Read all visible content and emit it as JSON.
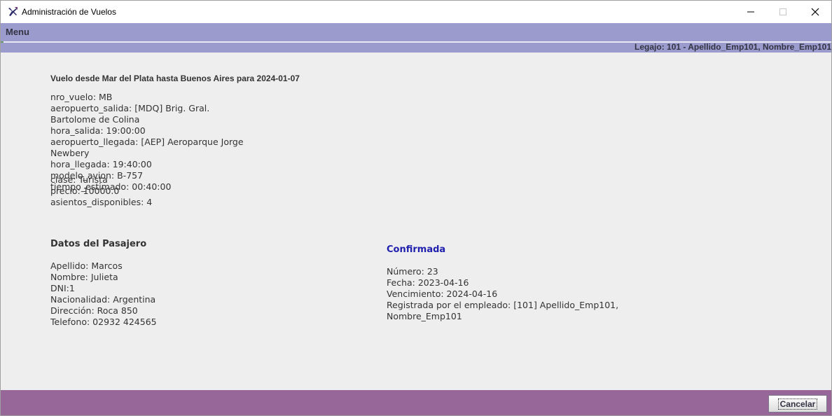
{
  "window": {
    "title": "Administración de Vuelos",
    "app_icon": "airplane-icon",
    "controls": [
      "minimize-icon",
      "maximize-icon",
      "close-icon"
    ]
  },
  "menubar": {
    "menu_label": "Menu"
  },
  "status": {
    "legajo": "Legajo: 101 - Apellido_Emp101, Nombre_Emp101"
  },
  "flight": {
    "title": "Vuelo desde Mar del Plata hasta Buenos Aires para 2024-01-07",
    "nro_vuelo": "nro_vuelo: MB",
    "aeropuerto_salida_l1": "aeropuerto_salida: [MDQ] Brig. Gral.",
    "aeropuerto_salida_l2": "Bartolome de Colina",
    "hora_salida": "hora_salida: 19:00:00",
    "aeropuerto_llegada_l1": "aeropuerto_llegada: [AEP] Aeroparque Jorge",
    "aeropuerto_llegada_l2": "Newbery",
    "hora_llegada": "hora_llegada: 19:40:00",
    "modelo_avion": "modelo_avion: B-757",
    "tiempo_estimado": "tiempo_estimado: 00:40:00",
    "clase": "clase: Turista",
    "precio": "precio: 10000.0",
    "asientos_disponibles": "asientos_disponibles: 4"
  },
  "passenger": {
    "heading": "Datos del Pasajero",
    "apellido": "Apellido: Marcos",
    "nombre": "Nombre: Julieta",
    "dni": "DNI:1",
    "nacionalidad": "Nacionalidad: Argentina",
    "direccion": "Dirección: Roca 850",
    "telefono": "Telefono: 02932 424565"
  },
  "reservation": {
    "status": "Confirmada",
    "status_color": "#1f1fae",
    "numero": "Número: 23",
    "fecha": "Fecha: 2023-04-16",
    "vencimiento": "Vencimiento: 2024-04-16",
    "registrada_l1": "Registrada por el empleado: [101] Apellido_Emp101,",
    "registrada_l2": "Nombre_Emp101"
  },
  "footer": {
    "cancel_label": "Cancelar"
  },
  "colors": {
    "menubar": "#9b9bcd",
    "footer": "#976799",
    "background": "#eeeeee"
  }
}
